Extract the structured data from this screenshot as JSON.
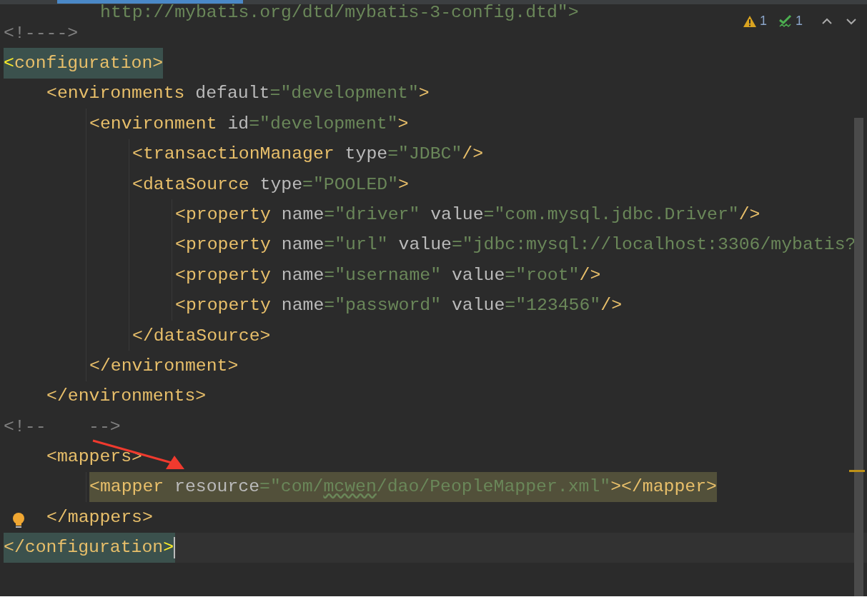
{
  "doctype_tail": "http://mybatis.org/dtd/mybatis-3-config.dtd\">",
  "inspections": {
    "warnings": "1",
    "typos": "1"
  },
  "lines": [
    {
      "kind": "plain",
      "current": false,
      "tokens": [
        {
          "kind": "comment",
          "text": "<!---->"
        }
      ]
    },
    {
      "kind": "match",
      "current": false,
      "tokens": [
        {
          "kind": "match",
          "text": "<"
        },
        {
          "kind": "tag",
          "text": "configuration>"
        }
      ],
      "children": [
        {
          "kind": "plain",
          "current": false,
          "tokens": [
            {
              "kind": "tag",
              "text": "<environments"
            },
            {
              "kind": "attr",
              "text": " default"
            },
            {
              "kind": "value",
              "text": "=\"development\""
            },
            {
              "kind": "tag",
              "text": ">"
            }
          ],
          "children": [
            {
              "kind": "plain",
              "current": false,
              "tokens": [
                {
                  "kind": "tag",
                  "text": "<environment"
                },
                {
                  "kind": "attr",
                  "text": " id"
                },
                {
                  "kind": "value",
                  "text": "=\"development\""
                },
                {
                  "kind": "tag",
                  "text": ">"
                }
              ],
              "children": [
                {
                  "kind": "plain",
                  "current": false,
                  "tokens": [
                    {
                      "kind": "tag",
                      "text": "<transactionManager"
                    },
                    {
                      "kind": "attr",
                      "text": " type"
                    },
                    {
                      "kind": "value",
                      "text": "=\"JDBC\""
                    },
                    {
                      "kind": "tag",
                      "text": "/>"
                    }
                  ]
                },
                {
                  "kind": "plain",
                  "current": false,
                  "tokens": [
                    {
                      "kind": "tag",
                      "text": "<dataSource"
                    },
                    {
                      "kind": "attr",
                      "text": " type"
                    },
                    {
                      "kind": "value",
                      "text": "=\"POOLED\""
                    },
                    {
                      "kind": "tag",
                      "text": ">"
                    }
                  ],
                  "children": [
                    {
                      "kind": "plain",
                      "current": false,
                      "tokens": [
                        {
                          "kind": "tag",
                          "text": "<property"
                        },
                        {
                          "kind": "attr",
                          "text": " name"
                        },
                        {
                          "kind": "value",
                          "text": "=\"driver\""
                        },
                        {
                          "kind": "attr",
                          "text": " value"
                        },
                        {
                          "kind": "value",
                          "text": "=\"com.mysql.jdbc.Driver\""
                        },
                        {
                          "kind": "tag",
                          "text": "/>"
                        }
                      ]
                    },
                    {
                      "kind": "plain",
                      "current": false,
                      "tokens": [
                        {
                          "kind": "tag",
                          "text": "<property"
                        },
                        {
                          "kind": "attr",
                          "text": " name"
                        },
                        {
                          "kind": "value",
                          "text": "=\"url\""
                        },
                        {
                          "kind": "attr",
                          "text": " value"
                        },
                        {
                          "kind": "value",
                          "text": "=\"jdbc:mysql://localhost:3306/mybatis?"
                        }
                      ]
                    },
                    {
                      "kind": "plain",
                      "current": false,
                      "tokens": [
                        {
                          "kind": "tag",
                          "text": "<property"
                        },
                        {
                          "kind": "attr",
                          "text": " name"
                        },
                        {
                          "kind": "value",
                          "text": "=\"username\""
                        },
                        {
                          "kind": "attr",
                          "text": " value"
                        },
                        {
                          "kind": "value",
                          "text": "=\"root\""
                        },
                        {
                          "kind": "tag",
                          "text": "/>"
                        }
                      ]
                    },
                    {
                      "kind": "plain",
                      "current": false,
                      "tokens": [
                        {
                          "kind": "tag",
                          "text": "<property"
                        },
                        {
                          "kind": "attr",
                          "text": " name"
                        },
                        {
                          "kind": "value",
                          "text": "=\"password\""
                        },
                        {
                          "kind": "attr",
                          "text": " value"
                        },
                        {
                          "kind": "value",
                          "text": "=\"123456\""
                        },
                        {
                          "kind": "tag",
                          "text": "/>"
                        }
                      ]
                    }
                  ]
                },
                {
                  "kind": "plain",
                  "current": false,
                  "tokens": [
                    {
                      "kind": "tag",
                      "text": "</dataSource>"
                    }
                  ]
                }
              ]
            },
            {
              "kind": "plain",
              "current": false,
              "tokens": [
                {
                  "kind": "tag",
                  "text": "</environment>"
                }
              ]
            }
          ]
        },
        {
          "kind": "plain",
          "current": false,
          "tokens": [
            {
              "kind": "tag",
              "text": "</environments>"
            }
          ]
        }
      ]
    },
    {
      "kind": "plain",
      "current": false,
      "tokens": [
        {
          "kind": "comment",
          "text": "<!--    -->"
        }
      ],
      "children": [
        {
          "kind": "plain",
          "current": false,
          "tokens": [
            {
              "kind": "tag",
              "text": "<mappers>"
            }
          ],
          "children": [
            {
              "kind": "usage",
              "current": false,
              "tokens": [
                {
                  "kind": "tag",
                  "text": "<mapper"
                },
                {
                  "kind": "attr",
                  "text": " resource"
                },
                {
                  "kind": "value",
                  "text": "=\"com/"
                },
                {
                  "kind": "typo",
                  "text": "mcwen"
                },
                {
                  "kind": "value",
                  "text": "/dao/PeopleMapper.xml\""
                },
                {
                  "kind": "tag",
                  "text": "></mapper>"
                }
              ]
            }
          ]
        },
        {
          "kind": "plain",
          "current": false,
          "tokens": [
            {
              "kind": "tag",
              "text": "</mappers>"
            }
          ]
        }
      ]
    },
    {
      "kind": "match",
      "current": true,
      "tokens": [
        {
          "kind": "tag",
          "text": "</configuration"
        },
        {
          "kind": "match",
          "text": ">"
        }
      ]
    }
  ]
}
